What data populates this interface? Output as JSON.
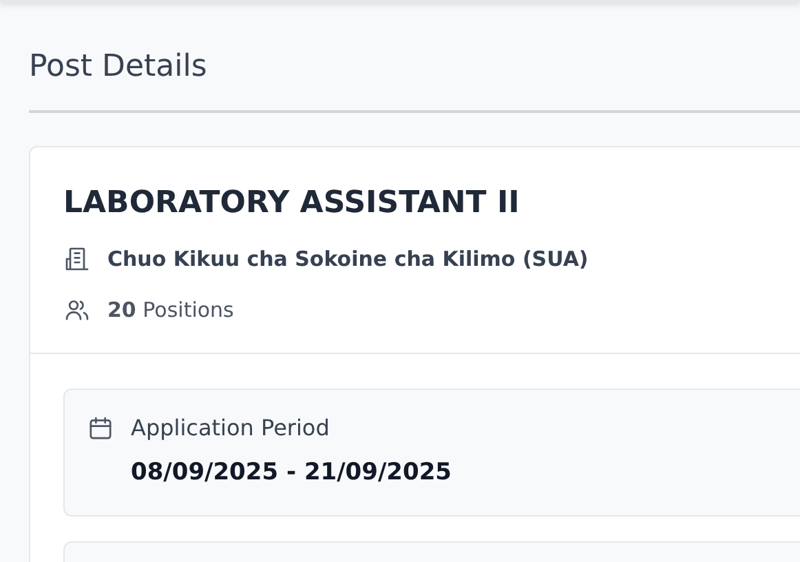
{
  "page_title": "Post Details",
  "post": {
    "title": "LABORATORY ASSISTANT II",
    "employer": "Chuo Kikuu cha Sokoine cha Kilimo (SUA)",
    "positions": "**20** Positions"
  },
  "details": [
    {
      "kind": "calendar",
      "label": "Application Period",
      "value": "08/09/2025 - 21/09/2025"
    }
  ]
}
